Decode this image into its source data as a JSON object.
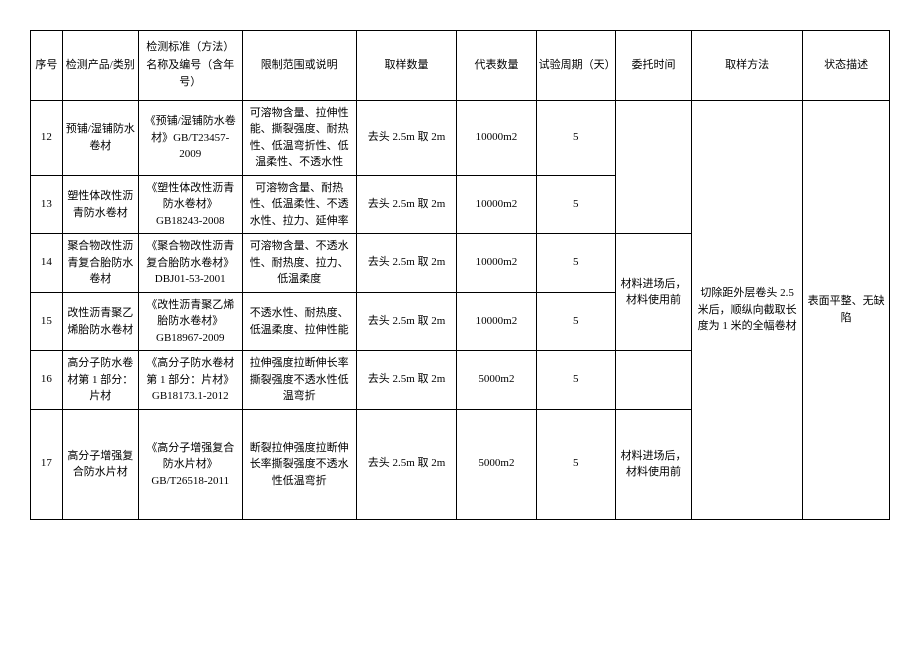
{
  "headers": {
    "seq": "序号",
    "product": "检测产品/类别",
    "standard": "检测标准（方法）名称及编号（含年号）",
    "limit": "限制范围或说明",
    "sample_qty": "取样数量",
    "rep_qty": "代表数量",
    "cycle": "试验周期（天）",
    "entrust_time": "委托时间",
    "method": "取样方法",
    "status": "状态描述"
  },
  "rows": [
    {
      "seq": "12",
      "product": "预铺/湿铺防水卷材",
      "standard": "《预铺/湿铺防水卷材》GB/T23457-2009",
      "limit": "可溶物含量、拉伸性能、撕裂强度、耐热性、低温弯折性、低温柔性、不透水性",
      "sample_qty": "去头 2.5m 取 2m",
      "rep_qty": "10000m2",
      "cycle": "5"
    },
    {
      "seq": "13",
      "product": "塑性体改性沥青防水卷材",
      "standard": "《塑性体改性沥青防水卷材》GB18243-2008",
      "limit": "可溶物含量、耐热性、低温柔性、不透水性、拉力、延伸率",
      "sample_qty": "去头 2.5m 取 2m",
      "rep_qty": "10000m2",
      "cycle": "5"
    },
    {
      "seq": "14",
      "product": "聚合物改性沥青复合胎防水卷材",
      "standard": "《聚合物改性沥青复合胎防水卷材》DBJ01-53-2001",
      "limit": "可溶物含量、不透水性、耐热度、拉力、低温柔度",
      "sample_qty": "去头 2.5m 取 2m",
      "rep_qty": "10000m2",
      "cycle": "5"
    },
    {
      "seq": "15",
      "product": "改性沥青聚乙烯胎防水卷材",
      "standard": "《改性沥青聚乙烯胎防水卷材》GB18967-2009",
      "limit": "不透水性、耐热度、低温柔度、拉伸性能",
      "sample_qty": "去头 2.5m 取 2m",
      "rep_qty": "10000m2",
      "cycle": "5"
    },
    {
      "seq": "16",
      "product": "高分子防水卷材第 1 部分：片材",
      "standard": "《高分子防水卷材第 1 部分：片材》GB18173.1-2012",
      "limit": "拉伸强度拉断伸长率撕裂强度不透水性低温弯折",
      "sample_qty": "去头 2.5m 取 2m",
      "rep_qty": "5000m2",
      "cycle": "5"
    },
    {
      "seq": "17",
      "product": "高分子增强复合防水片材",
      "standard": "《高分子增强复合防水片材》GB/T26518-2011",
      "limit": "断裂拉伸强度拉断伸长率撕裂强度不透水性低温弯折",
      "sample_qty": "去头 2.5m 取 2m",
      "rep_qty": "5000m2",
      "cycle": "5"
    }
  ],
  "merged": {
    "entrust_time_1": "材料进场后，材料使用前",
    "entrust_time_2": "材料进场后，材料使用前",
    "method": "切除距外层卷头 2.5 米后，顺纵向截取长度为 1 米的全幅卷材",
    "status": "表面平整、无缺陷"
  }
}
